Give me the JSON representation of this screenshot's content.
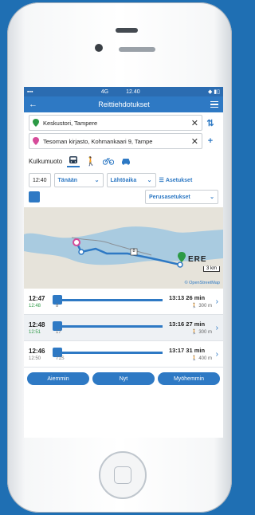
{
  "status": {
    "network": "4G",
    "time": "12.40"
  },
  "nav": {
    "title": "Reittiehdotukset"
  },
  "from": {
    "value": "Keskustori, Tampere"
  },
  "to": {
    "value": "Tesoman kirjasto, Kohmankaari 9, Tampe"
  },
  "modes": {
    "label": "Kulkumuoto"
  },
  "filters": {
    "time": "12:40",
    "day": "Tänään",
    "type": "Lähtöaika",
    "settings": "Asetukset",
    "preset": "Perusasetukset"
  },
  "map": {
    "scale": "3 km",
    "credit": "© OpenStreetMap",
    "route_label": "8",
    "place_label": "ERE"
  },
  "routes": [
    {
      "dep": "12:47",
      "sub": "12:48",
      "line": "8",
      "arr": "13:13",
      "dur": "26 min",
      "walk": "300 m"
    },
    {
      "dep": "12:48",
      "sub": "12:51",
      "line": "17",
      "arr": "13:16",
      "dur": "27 min",
      "walk": "300 m"
    },
    {
      "dep": "12:46",
      "sub": "12:50",
      "line": "71S",
      "arr": "13:17",
      "dur": "31 min",
      "walk": "400 m"
    }
  ],
  "bottom": {
    "earlier": "Aiemmin",
    "now": "Nyt",
    "later": "Myöhemmin"
  },
  "colors": {
    "accent": "#2e79c4",
    "green": "#2c9a45",
    "pink": "#d64b9a"
  }
}
